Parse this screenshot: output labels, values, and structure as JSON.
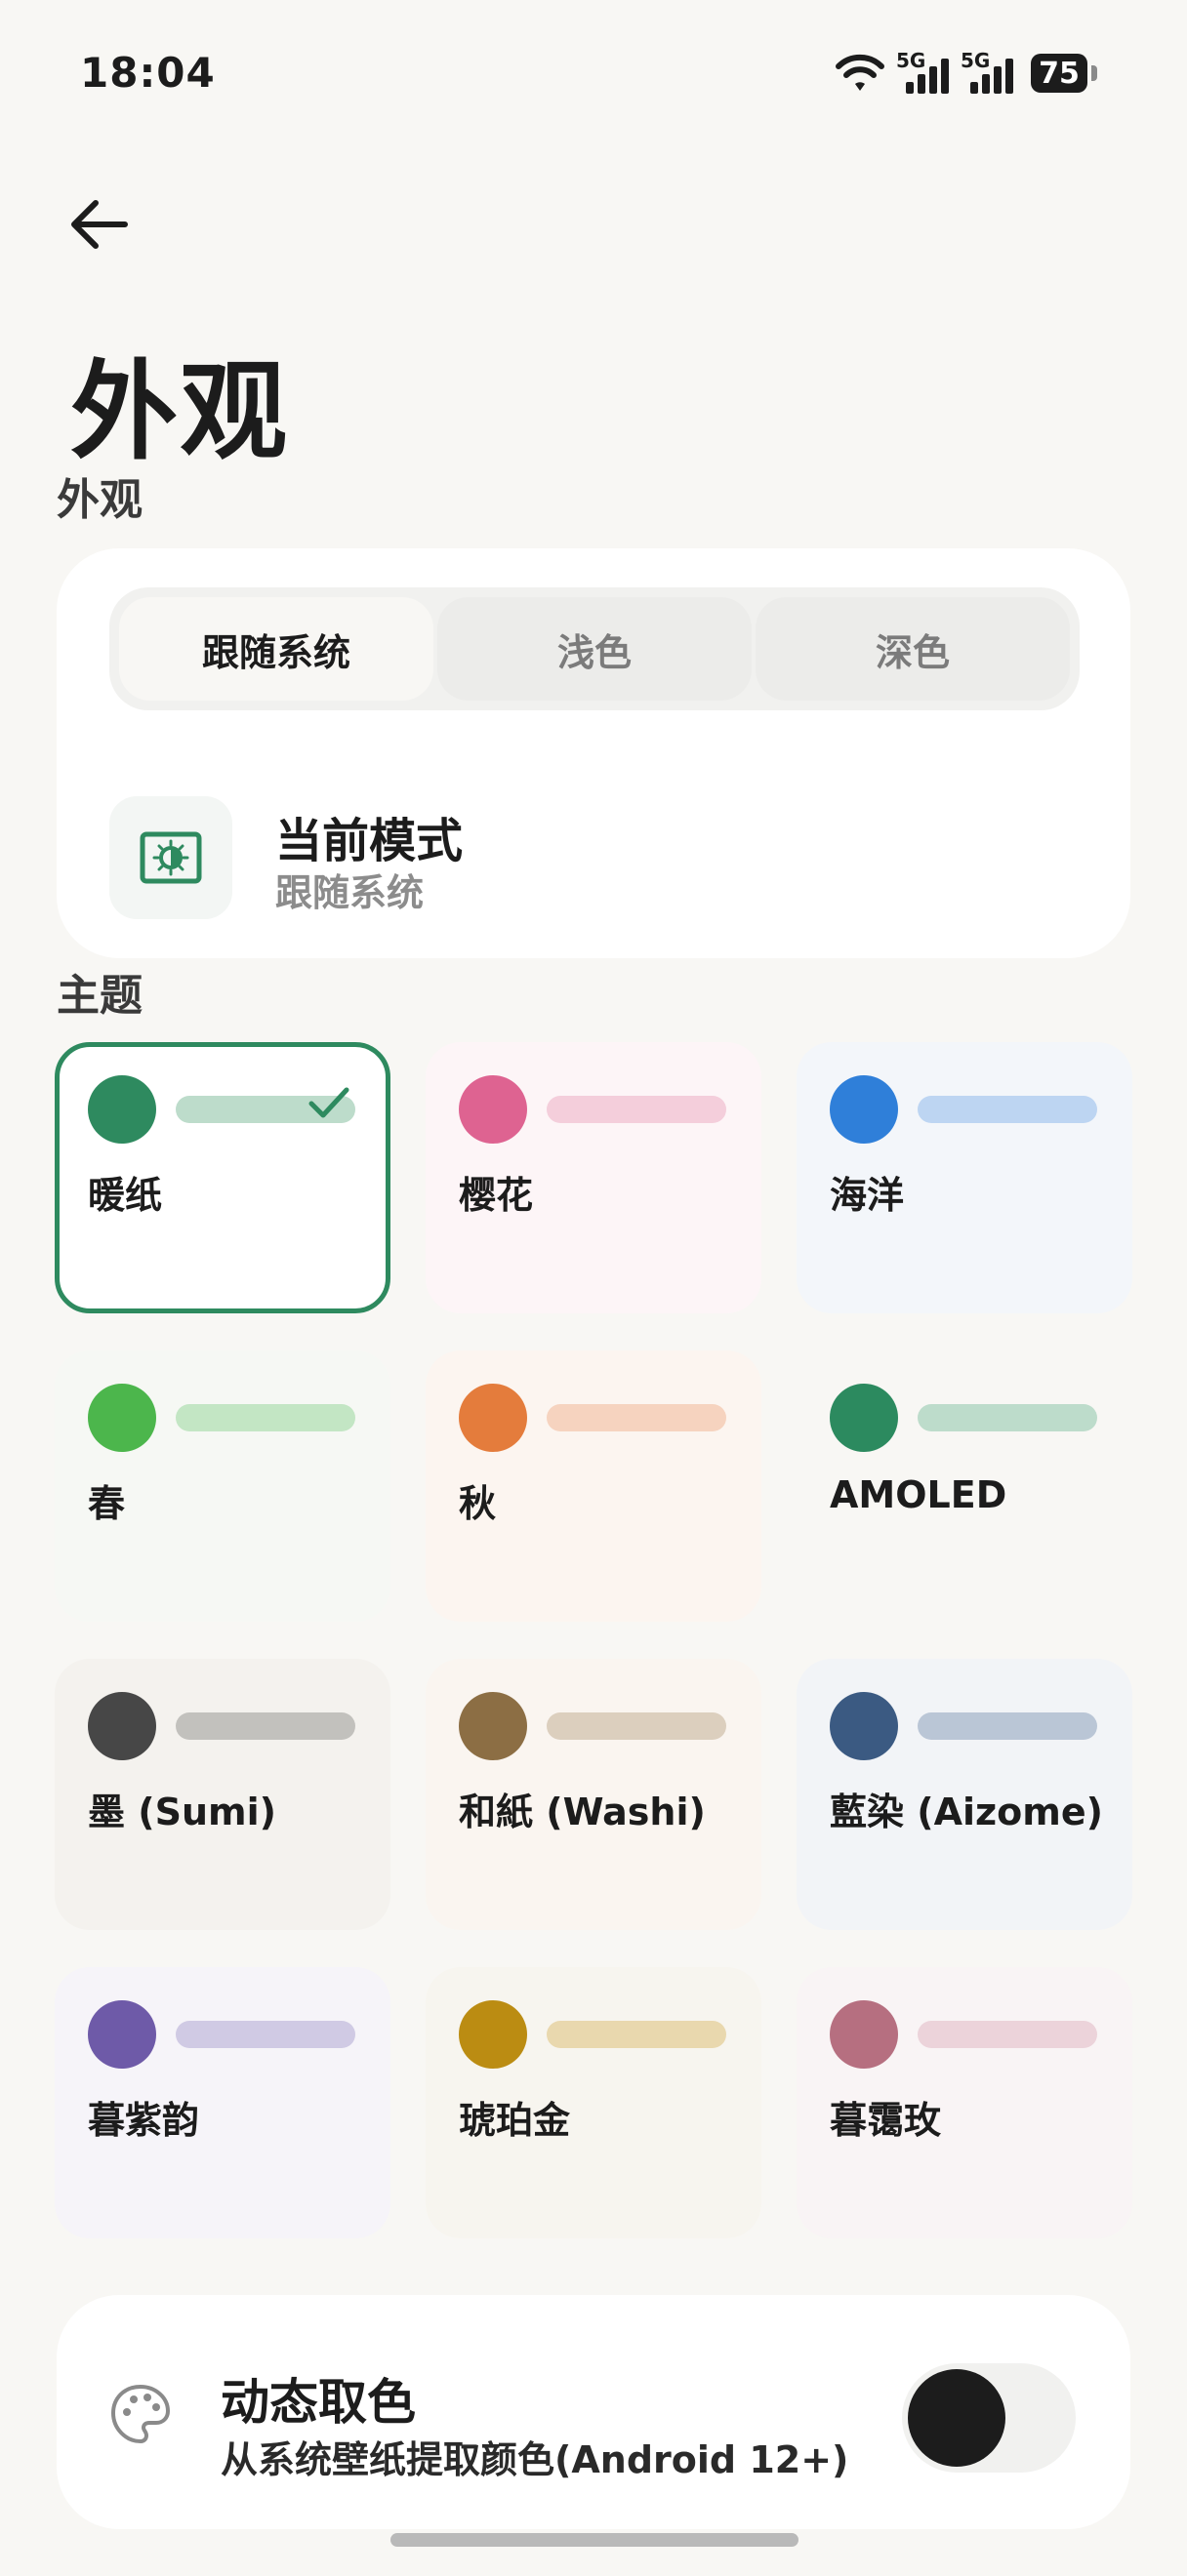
{
  "status_bar": {
    "time": "18:04",
    "signal_1_label": "5G",
    "signal_2_label": "5G",
    "battery": "75"
  },
  "header": {
    "back_icon": "arrow-left-icon",
    "title": "外观"
  },
  "appearance_section": {
    "label": "外观",
    "mode_options": [
      "跟随系统",
      "浅色",
      "深色"
    ],
    "selected_mode": "跟随系统",
    "current_mode_title": "当前模式",
    "current_mode_value": "跟随系统"
  },
  "theme_section": {
    "label": "主题",
    "selected": "暖纸",
    "themes": [
      {
        "name": "暖纸",
        "color": "#2e8a5f",
        "pill": "#bddccb",
        "bg": "#ffffff"
      },
      {
        "name": "樱花",
        "color": "#de6391",
        "pill": "#f4cedb",
        "bg": "#fdf5f7"
      },
      {
        "name": "海洋",
        "color": "#2f7fd9",
        "pill": "#bdd5f2",
        "bg": "#f3f6fa"
      },
      {
        "name": "春",
        "color": "#4cb64c",
        "pill": "#c3e6c4",
        "bg": "#f6f8f4"
      },
      {
        "name": "秋",
        "color": "#e47c3c",
        "pill": "#f6d3bf",
        "bg": "#fcf5f0"
      },
      {
        "name": "AMOLED",
        "color": "#2c8a5f",
        "pill": "#bddccb",
        "bg": "#f8f7f4"
      },
      {
        "name": "墨 (Sumi)",
        "color": "#474747",
        "pill": "#c2c1bd",
        "bg": "#f4f2ee"
      },
      {
        "name": "和紙 (Washi)",
        "color": "#8c6e44",
        "pill": "#dccfbe",
        "bg": "#faf5f0"
      },
      {
        "name": "藍染 (Aizome)",
        "color": "#3b5a82",
        "pill": "#bac6d6",
        "bg": "#f2f4f7"
      },
      {
        "name": "暮紫韵",
        "color": "#6e5aa8",
        "pill": "#d0cae4",
        "bg": "#f6f4f9"
      },
      {
        "name": "琥珀金",
        "color": "#bb8c12",
        "pill": "#e9d8ae",
        "bg": "#f7f5ef"
      },
      {
        "name": "暮霭玫",
        "color": "#b66f80",
        "pill": "#ecd3da",
        "bg": "#f9f4f5"
      }
    ]
  },
  "dynamic_color": {
    "icon": "palette-icon",
    "title": "动态取色",
    "subtitle": "从系统壁纸提取颜色(Android 12+)",
    "enabled": false
  },
  "colors": {
    "accent": "#2e8a5f",
    "background": "#f8f7f4",
    "card": "#ffffff"
  }
}
